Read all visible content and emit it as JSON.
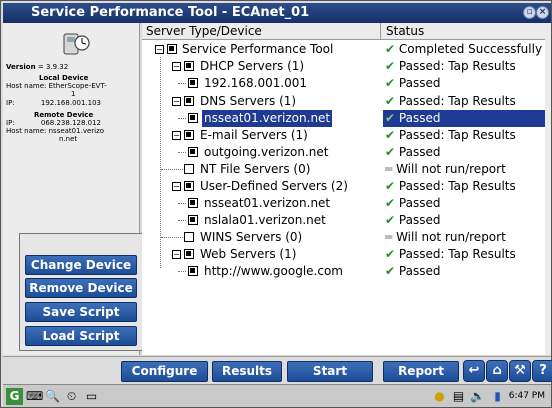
{
  "window": {
    "title": "Service Performance Tool - ECAnet_01"
  },
  "left_panel": {
    "version_label": "Version",
    "version_value": "= 3.9.32",
    "local_device_heading": "Local Device",
    "local_host_label": "Host name:",
    "local_host_value": "EtherScope-EVT-",
    "local_host_value2": "1",
    "local_ip_label": "IP:",
    "local_ip_value": "192.168.001.103",
    "remote_device_heading": "Remote Device",
    "remote_ip_label": "IP:",
    "remote_ip_value": "068.238.128.012",
    "remote_host_label": "Host name:",
    "remote_host_value": "nsseat01.verizo",
    "remote_host_value2": "n.net",
    "buttons": {
      "change_device": "Change Device",
      "remove_device": "Remove Device",
      "save_script": "Save Script",
      "load_script": "Load Script"
    }
  },
  "table": {
    "headers": {
      "col1": "Server Type/Device",
      "col2": "Status"
    },
    "rows": [
      {
        "name": "Service Performance Tool",
        "status": "Completed Successfully",
        "status_kind": "ok"
      },
      {
        "name": "DHCP Servers (1)",
        "status": "Passed: Tap Results",
        "status_kind": "ok"
      },
      {
        "name": "192.168.001.001",
        "status": "Passed",
        "status_kind": "ok"
      },
      {
        "name": "DNS Servers (1)",
        "status": "Passed: Tap Results",
        "status_kind": "ok"
      },
      {
        "name": "nsseat01.verizon.net",
        "status": "Passed",
        "status_kind": "ok"
      },
      {
        "name": "E-mail Servers (1)",
        "status": "Passed: Tap Results",
        "status_kind": "ok"
      },
      {
        "name": "outgoing.verizon.net",
        "status": "Passed",
        "status_kind": "ok"
      },
      {
        "name": "NT File Servers (0)",
        "status": "Will not run/report",
        "status_kind": "na"
      },
      {
        "name": "User-Defined Servers (2)",
        "status": "Passed: Tap Results",
        "status_kind": "ok"
      },
      {
        "name": "nsseat01.verizon.net",
        "status": "Passed",
        "status_kind": "ok"
      },
      {
        "name": "nslala01.verizon.net",
        "status": "Passed",
        "status_kind": "ok"
      },
      {
        "name": "WINS Servers (0)",
        "status": "Will not run/report",
        "status_kind": "na"
      },
      {
        "name": "Web Servers (1)",
        "status": "Passed: Tap Results",
        "status_kind": "ok"
      },
      {
        "name": "http://www.google.com",
        "status": "Passed",
        "status_kind": "ok"
      }
    ]
  },
  "bottom_bar": {
    "configure": "Configure",
    "results": "Results",
    "start": "Start",
    "report": "Report",
    "help": "?"
  },
  "taskbar": {
    "clock": "6:47 PM"
  },
  "icons": {
    "ok": "green-checkmark",
    "na": "gray-dash"
  }
}
